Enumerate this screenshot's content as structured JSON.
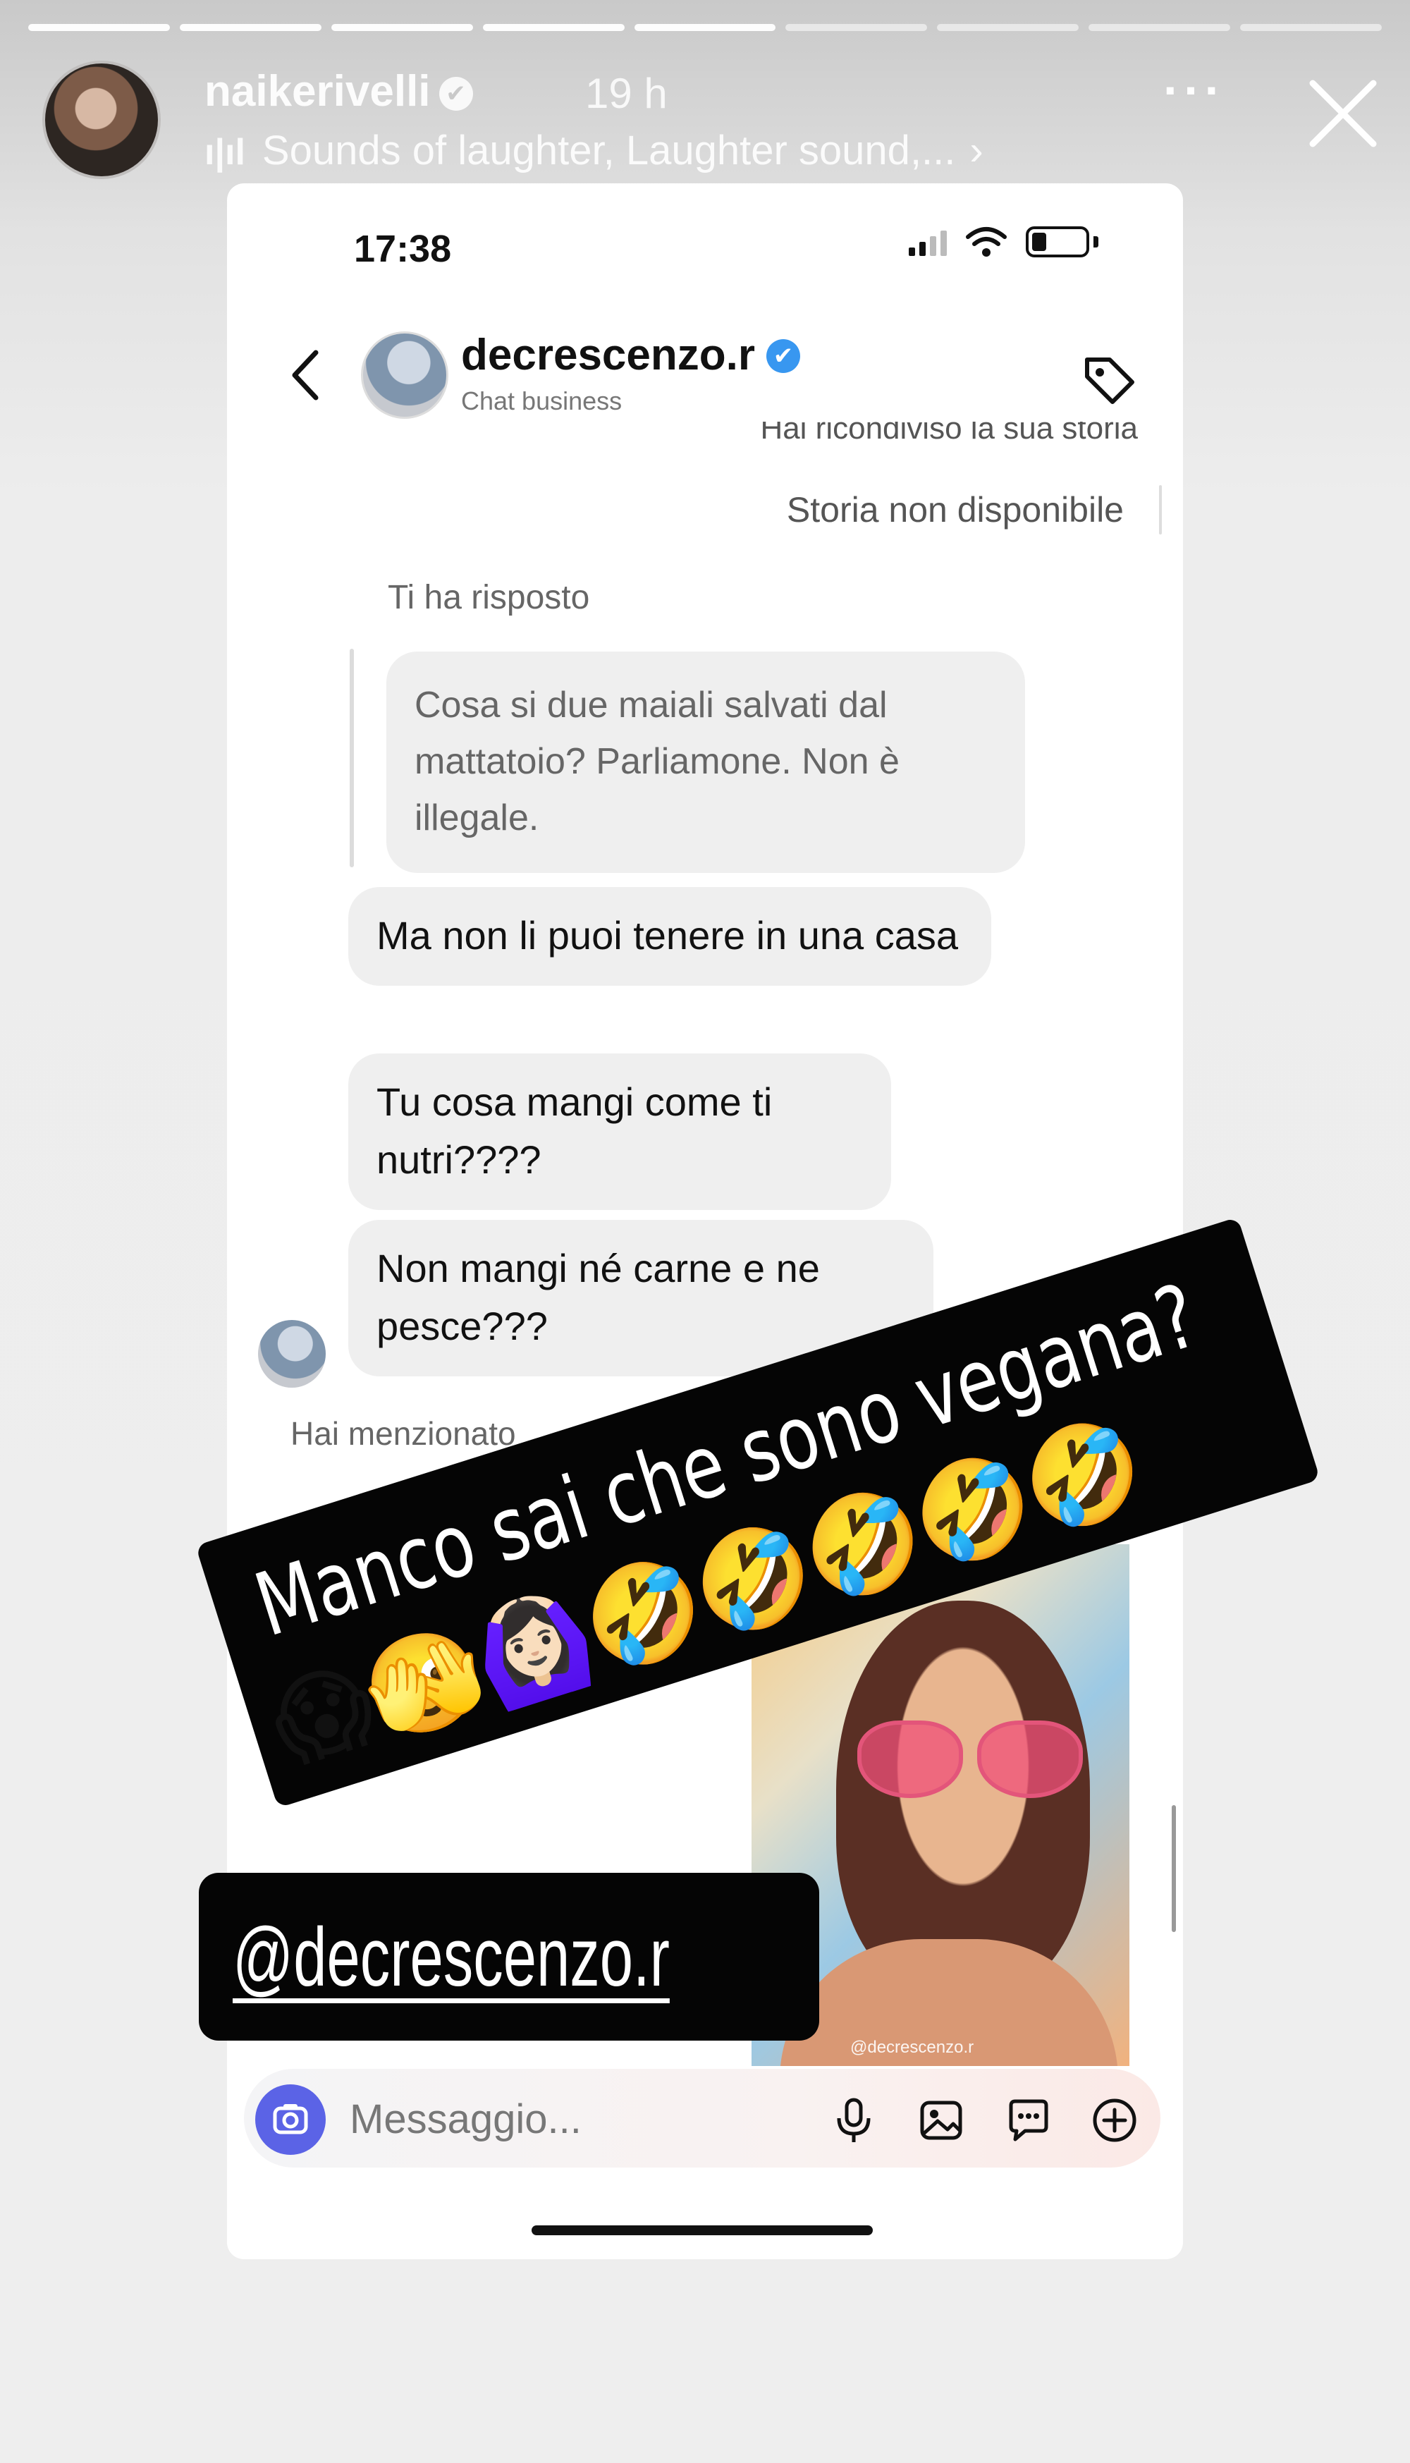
{
  "story": {
    "username": "naikerivelli",
    "verified_glyph": "✔",
    "time_ago": "19 h",
    "music_icon": "music-bars-icon",
    "music_glyph": "ı|ıl",
    "music_title": "Sounds of laughter, Laughter sound,...",
    "music_chevron": "›",
    "more_glyph": "···",
    "segments_total": 9,
    "segments_done": 5
  },
  "screenshot": {
    "status_time": "17:38",
    "chat": {
      "name": "decrescenzo.r",
      "verified_glyph": "✔",
      "subtitle": "Chat business",
      "shared_note": "Hai ricondiviso la sua storia",
      "unavailable": "Storia non disponibile",
      "reply_label": "Ti ha risposto",
      "quoted_message": "Cosa si due maiali salvati dal mattatoio? Parliamone. Non è illegale.",
      "messages": [
        "Ma non li puoi tenere in una casa",
        "Tu cosa mangi come ti nutri????",
        "Non mangi né carne e ne pesce???"
      ],
      "mention_note": "Hai menzionato",
      "video_watermark": "@decrescenzo.r"
    },
    "composer": {
      "placeholder": "Messaggio..."
    }
  },
  "stickers": {
    "caption_line1": "Manco sai che sono vegana?",
    "caption_line2": "😱🫣🙆🏻‍♀️🤣🤣🤣🤣🤣",
    "mention": "@decrescenzo.r"
  },
  "colors": {
    "accent_blue": "#3897f0",
    "camera_purple": "#5b63e6",
    "sticker_black": "#050505"
  }
}
